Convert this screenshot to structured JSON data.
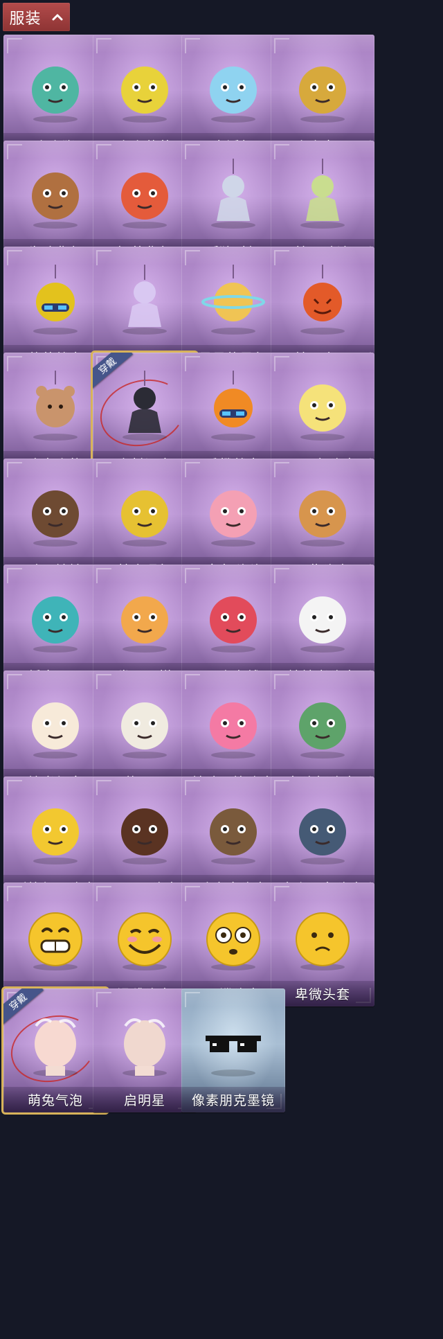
{
  "header": {
    "title": "服装",
    "toggle_icon": "chevron-up-icon"
  },
  "items": [
    {
      "name": "小小猴",
      "theme": "purple",
      "icon": "monkey-icon",
      "accent": "#4fb6a2",
      "equipped": false
    },
    {
      "name": "小小菠萝",
      "theme": "purple",
      "icon": "pineapple-icon",
      "accent": "#e8d23a",
      "equipped": false
    },
    {
      "name": "夜浮船",
      "theme": "purple",
      "icon": "jellyfish-icon",
      "accent": "#8fd3f0",
      "equipped": false
    },
    {
      "name": "小小女王",
      "theme": "purple",
      "icon": "queen-icon",
      "accent": "#d7a93c",
      "equipped": false
    },
    {
      "name": "牛啤背包",
      "theme": "purple",
      "icon": "beer-mug-icon",
      "accent": "#b07040",
      "equipped": false
    },
    {
      "name": "奶茶背包",
      "theme": "purple",
      "icon": "milk-tea-icon",
      "accent": "#e45b3b",
      "equipped": false
    },
    {
      "name": "孤独对望",
      "theme": "purple",
      "icon": "charm-figure-icon",
      "accent": "#cfd6e8",
      "equipped": false
    },
    {
      "name": "桂冠聆诗",
      "theme": "purple",
      "icon": "charm-figure-icon",
      "accent": "#c9dd8f",
      "equipped": false
    },
    {
      "name": "菠萝战宝",
      "theme": "purple",
      "icon": "robot-charm-icon",
      "accent": "#e3c21d",
      "equipped": false
    },
    {
      "name": "清辉伴影",
      "theme": "purple",
      "icon": "charm-figure-icon",
      "accent": "#d9c8f2",
      "equipped": false
    },
    {
      "name": "星星的勇气",
      "theme": "purple",
      "icon": "planet-charm-icon",
      "accent": "#f0c454",
      "equipped": false
    },
    {
      "name": "糖果守卫",
      "theme": "purple",
      "icon": "pumpkin-charm-icon",
      "accent": "#e35a29",
      "equipped": false
    },
    {
      "name": "晚安小熊",
      "theme": "purple",
      "icon": "bear-charm-icon",
      "accent": "#c9946c",
      "equipped": false
    },
    {
      "name": "尘封旧事",
      "theme": "purple",
      "icon": "charm-figure-icon",
      "accent": "#2b2b35",
      "equipped": true,
      "badge": "穿戴"
    },
    {
      "name": "香橙战宝",
      "theme": "purple",
      "icon": "robot-charm-icon",
      "accent": "#f08a24",
      "equipped": false
    },
    {
      "name": "显眼包头套",
      "theme": "purple",
      "icon": "bulb-head-icon",
      "accent": "#f5e27a",
      "equipped": false
    },
    {
      "name": "辟邪娃娃",
      "theme": "purple",
      "icon": "doll-head-icon",
      "accent": "#6e4a32",
      "equipped": false
    },
    {
      "name": "禁止通行",
      "theme": "purple",
      "icon": "traffic-cone-icon",
      "accent": "#e6c132",
      "equipped": false
    },
    {
      "name": "章鱼啵啵",
      "theme": "purple",
      "icon": "octopus-icon",
      "accent": "#f4a0b4",
      "equipped": false
    },
    {
      "name": "阿柴头套",
      "theme": "purple",
      "icon": "shiba-head-icon",
      "accent": "#d7954d",
      "equipped": false
    },
    {
      "name": "纸盒霸王",
      "theme": "purple",
      "icon": "dino-box-icon",
      "accent": "#3fb4b8",
      "equipped": false
    },
    {
      "name": "卷王蛋糕",
      "theme": "purple",
      "icon": "cake-roll-icon",
      "accent": "#f2a84c",
      "equipped": false
    },
    {
      "name": "马上有钱",
      "theme": "purple",
      "icon": "horse-head-icon",
      "accent": "#e24b5b",
      "equipped": false
    },
    {
      "name": "饺饺者头套",
      "theme": "purple",
      "icon": "dumpling-head-icon",
      "accent": "#f4f4f4",
      "equipped": false
    },
    {
      "name": "烛光纪念",
      "theme": "purple",
      "icon": "candle-head-icon",
      "accent": "#f7ead9",
      "equipped": false
    },
    {
      "name": "蒜了八",
      "theme": "purple",
      "icon": "garlic-head-icon",
      "accent": "#f0ebe0",
      "equipped": false
    },
    {
      "name": "精致露比头套",
      "theme": "purple",
      "icon": "ruby-head-icon",
      "accent": "#f47aa4",
      "equipped": false
    },
    {
      "name": "鱼头怪头套",
      "theme": "purple",
      "icon": "fish-head-icon",
      "accent": "#5ea36a",
      "equipped": false
    },
    {
      "name": "烈焰红唇头套",
      "theme": "purple",
      "icon": "yellow-mouse-head-icon",
      "accent": "#f2c830",
      "equipped": false
    },
    {
      "name": "面具马头套",
      "theme": "purple",
      "icon": "horse-mask-icon",
      "accent": "#5a3322",
      "equipped": false
    },
    {
      "name": "哈士奇头套",
      "theme": "purple",
      "icon": "husky-head-icon",
      "accent": "#7a5a3c",
      "equipped": false
    },
    {
      "name": "卡斑甲鱼头套",
      "theme": "purple",
      "icon": "seal-head-icon",
      "accent": "#455a75",
      "equipped": false
    },
    {
      "name": "嘻嘻头套",
      "theme": "purple",
      "icon": "grin-emoji-icon",
      "accent": "#f5c52c",
      "equipped": false
    },
    {
      "name": "滑稽头套",
      "theme": "purple",
      "icon": "smirk-emoji-icon",
      "accent": "#f5c52c",
      "equipped": false
    },
    {
      "name": "呆滞头套",
      "theme": "purple",
      "icon": "stare-emoji-icon",
      "accent": "#f5c52c",
      "equipped": false
    },
    {
      "name": "卑微头套",
      "theme": "purple",
      "icon": "humble-emoji-icon",
      "accent": "#f5c52c",
      "equipped": false
    },
    {
      "name": "萌兔气泡",
      "theme": "purple",
      "icon": "bubble-head-icon",
      "accent": "#f7d9d1",
      "equipped": true,
      "badge": "穿戴"
    },
    {
      "name": "启明星",
      "theme": "purple",
      "icon": "bubble-head-icon",
      "accent": "#f0d8cf",
      "equipped": false
    },
    {
      "name": "像素朋克墨镜",
      "theme": "blue",
      "icon": "pixel-sunglasses-icon",
      "accent": "#111111",
      "equipped": false
    }
  ]
}
